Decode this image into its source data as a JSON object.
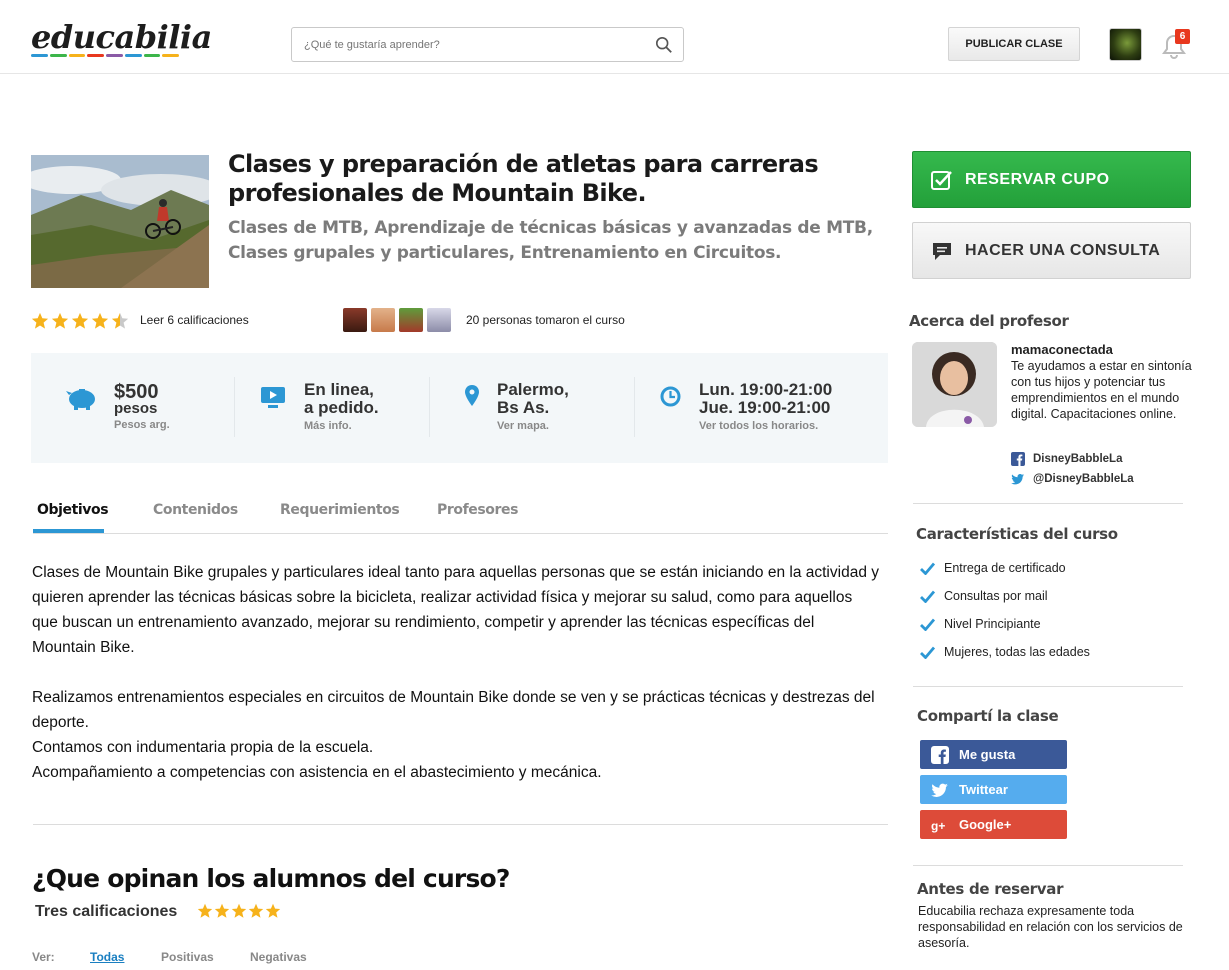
{
  "header": {
    "logo": "educabilia",
    "logo_colors": [
      "#2c97d4",
      "#3cb54a",
      "#f6b21b",
      "#e8381e",
      "#8a5aa6",
      "#2c97d4",
      "#3cb54a",
      "#f6b21b"
    ],
    "search_placeholder": "¿Qué te gustaría aprender?",
    "publish_label": "PUBLICAR CLASE",
    "notification_count": "6"
  },
  "course": {
    "title": "Clases y preparación de atletas para carreras profesionales de Mountain Bike.",
    "subtitle": "Clases de MTB, Aprendizaje de técnicas básicas y avanzadas de MTB, Clases grupales y particulares, Entrenamiento en Circuitos.",
    "rating": 4.5,
    "ratings_link": "Leer 6 calificaciones",
    "people_text": "20 personas tomaron el curso"
  },
  "info": {
    "price": "$500",
    "price_unit": "pesos",
    "price_note": "Pesos arg.",
    "mode_line1": "En linea,",
    "mode_line2": "a pedido.",
    "mode_note": "Más info.",
    "place_line1": "Palermo,",
    "place_line2": "Bs As.",
    "place_note": "Ver mapa.",
    "time_line1": "Lun. 19:00-21:00",
    "time_line2": "Jue. 19:00-21:00",
    "time_note": "Ver todos los horarios."
  },
  "tabs": [
    {
      "label": "Objetivos"
    },
    {
      "label": "Contenidos"
    },
    {
      "label": "Requerimientos"
    },
    {
      "label": "Profesores"
    }
  ],
  "description": {
    "p1": "Clases de Mountain Bike grupales y particulares ideal tanto para aquellas personas que se están iniciando en la actividad y quieren aprender las técnicas básicas sobre la bicicleta, realizar actividad física y mejorar su salud, como para aquellos que buscan un entrenamiento avanzado, mejorar su rendimiento, competir y aprender las técnicas específicas del Mountain Bike.",
    "p2": "Realizamos entrenamientos especiales en circuitos de Mountain Bike donde se ven y se prácticas técnicas y destrezas del deporte.",
    "p3": "Contamos con indumentaria propia de la escuela.",
    "p4": "Acompañamiento a competencias con asistencia en el abastecimiento y mecánica."
  },
  "reviews": {
    "title": "¿Que opinan los alumnos del curso?",
    "subtitle": "Tres calificaciones",
    "stars": 5,
    "filter_label": "Ver:",
    "filters": [
      "Todas",
      "Positivas",
      "Negativas"
    ]
  },
  "sidebar": {
    "reserve_label": "RESERVAR CUPO",
    "consult_label": "HACER UNA CONSULTA",
    "about_title": "Acerca del profesor",
    "prof_name": "mamaconectada",
    "prof_bio": "Te ayudamos a estar en sintonía con tus hijos y potenciar tus emprendimientos en el mundo digital. Capacitaciones online.",
    "facebook": "DisneyBabbleLa",
    "twitter": "@DisneyBabbleLa",
    "features_title": "Características del curso",
    "features": [
      "Entrega de certificado",
      "Consultas por mail",
      "Nivel Principiante",
      "Mujeres, todas las edades"
    ],
    "share_title": "Compartí la clase",
    "share_buttons": [
      "Me gusta",
      "Twittear",
      "Google+"
    ],
    "before_title": "Antes de reservar",
    "before_text": "Educabilia rechaza expresamente toda responsabilidad en relación con los servicios de asesoría."
  },
  "colors": {
    "accent": "#2c97d4",
    "reserve": "#2aab41",
    "star": "#f6b21b",
    "facebook": "#3b5998",
    "twitter": "#55acee",
    "google": "#dd4b39"
  }
}
